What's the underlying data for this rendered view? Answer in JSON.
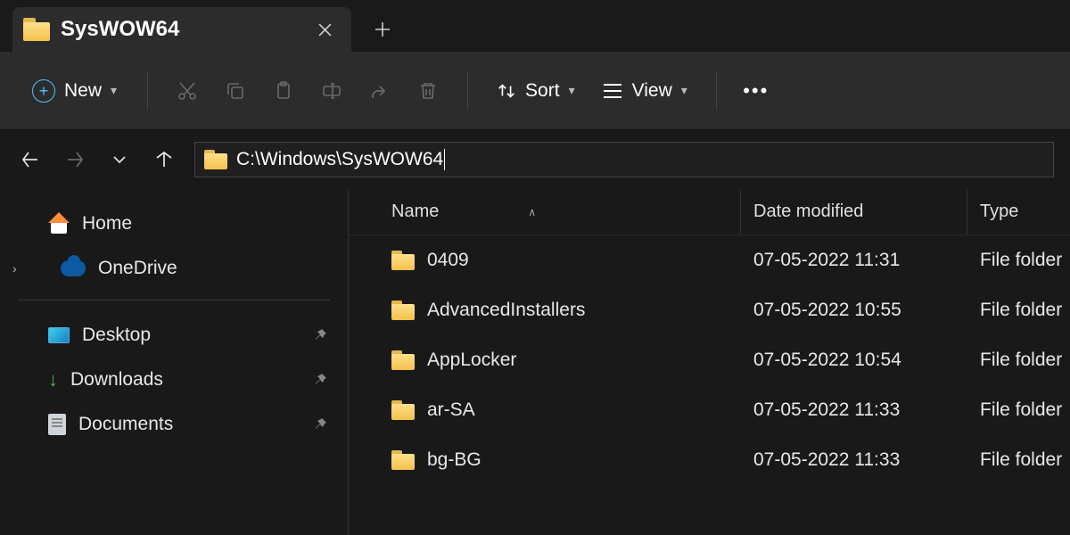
{
  "tab": {
    "title": "SysWOW64"
  },
  "toolbar": {
    "new_label": "New",
    "sort_label": "Sort",
    "view_label": "View"
  },
  "address": {
    "path": "C:\\Windows\\SysWOW64"
  },
  "sidebar": {
    "home": "Home",
    "onedrive": "OneDrive",
    "quick": [
      {
        "label": "Desktop"
      },
      {
        "label": "Downloads"
      },
      {
        "label": "Documents"
      }
    ]
  },
  "columns": {
    "name": "Name",
    "date": "Date modified",
    "type": "Type"
  },
  "rows": [
    {
      "name": "0409",
      "date": "07-05-2022 11:31",
      "type": "File folder"
    },
    {
      "name": "AdvancedInstallers",
      "date": "07-05-2022 10:55",
      "type": "File folder"
    },
    {
      "name": "AppLocker",
      "date": "07-05-2022 10:54",
      "type": "File folder"
    },
    {
      "name": "ar-SA",
      "date": "07-05-2022 11:33",
      "type": "File folder"
    },
    {
      "name": "bg-BG",
      "date": "07-05-2022 11:33",
      "type": "File folder"
    }
  ]
}
